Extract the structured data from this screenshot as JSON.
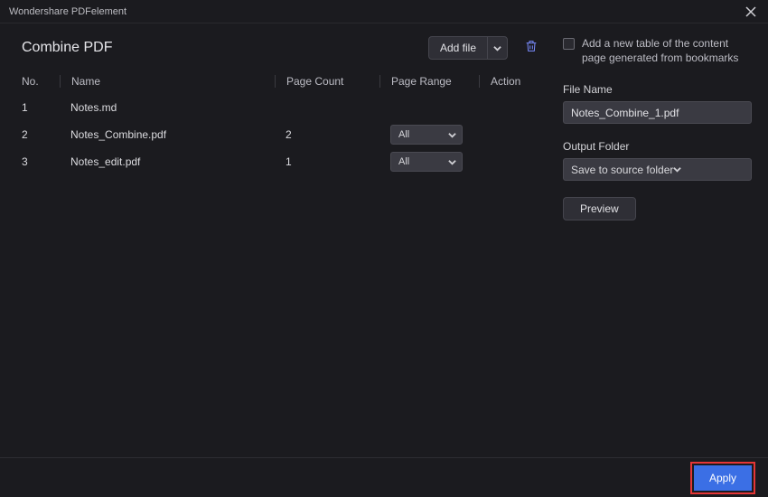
{
  "app_title": "Wondershare PDFelement",
  "main": {
    "title": "Combine PDF",
    "add_file_label": "Add file",
    "columns": {
      "no": "No.",
      "name": "Name",
      "page_count": "Page Count",
      "page_range": "Page Range",
      "action": "Action"
    },
    "rows": [
      {
        "no": "1",
        "name": "Notes.md",
        "page_count": "",
        "page_range": ""
      },
      {
        "no": "2",
        "name": "Notes_Combine.pdf",
        "page_count": "2",
        "page_range": "All"
      },
      {
        "no": "3",
        "name": "Notes_edit.pdf",
        "page_count": "1",
        "page_range": "All"
      }
    ]
  },
  "side": {
    "checkbox_label": "Add a new table of the content page generated from bookmarks",
    "file_name_label": "File Name",
    "file_name_value": "Notes_Combine_1.pdf",
    "output_folder_label": "Output Folder",
    "output_folder_value": "Save to source folder",
    "preview_label": "Preview"
  },
  "footer": {
    "apply_label": "Apply"
  }
}
